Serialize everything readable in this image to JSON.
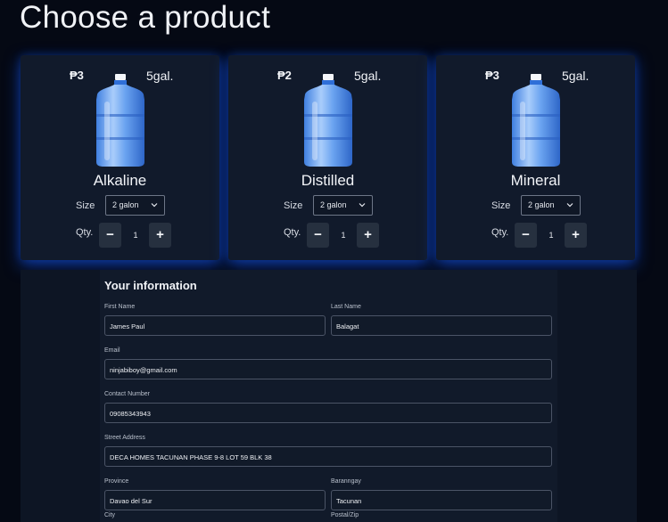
{
  "page": {
    "heading": "Choose a product"
  },
  "products": [
    {
      "price": "₱3",
      "volume": "5gal.",
      "name": "Alkaline",
      "size_label": "Size",
      "size_value": "2 galon",
      "qty_label": "Qty.",
      "qty": "1",
      "minus": "−",
      "plus": "+"
    },
    {
      "price": "₱2",
      "volume": "5gal.",
      "name": "Distilled",
      "size_label": "Size",
      "size_value": "2 galon",
      "qty_label": "Qty.",
      "qty": "1",
      "minus": "−",
      "plus": "+"
    },
    {
      "price": "₱3",
      "volume": "5gal.",
      "name": "Mineral",
      "size_label": "Size",
      "size_value": "2 galon",
      "qty_label": "Qty.",
      "qty": "1",
      "minus": "−",
      "plus": "+"
    }
  ],
  "info": {
    "title": "Your information",
    "first_name": {
      "label": "First Name",
      "value": "James Paul"
    },
    "last_name": {
      "label": "Last Name",
      "value": "Balagat"
    },
    "email": {
      "label": "Email",
      "value": "ninjabiboy@gmail.com"
    },
    "contact": {
      "label": "Contact Number",
      "value": "09085343943"
    },
    "street": {
      "label": "Street Address",
      "value": "DECA HOMES TACUNAN PHASE 9-8 LOT 59 BLK 38"
    },
    "province": {
      "label": "Province",
      "value": "Davao del Sur"
    },
    "barangay": {
      "label": "Baranngay",
      "value": "Tacunan"
    },
    "city": {
      "label": "City"
    },
    "postal": {
      "label": "Postal/Zip"
    }
  },
  "colors": {
    "accent_glow": "#1e5aff",
    "card_bg": "#111a2b",
    "page_bg": "#050914"
  },
  "icons": {
    "bottle": "water-jug-icon",
    "chevron": "chevron-down-icon"
  }
}
